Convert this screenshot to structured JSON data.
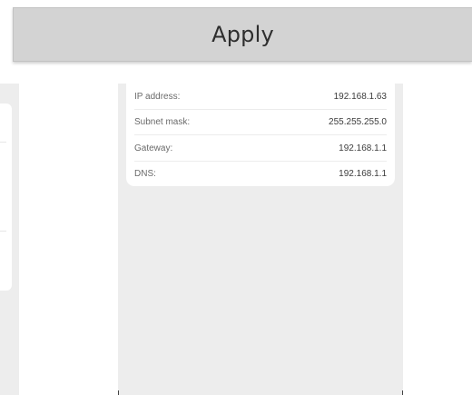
{
  "apply_bar": {
    "label": "Apply"
  },
  "network_info": {
    "rows": [
      {
        "label": "IP address:",
        "value": "192.168.1.63"
      },
      {
        "label": "Subnet mask:",
        "value": "255.255.255.0"
      },
      {
        "label": "Gateway:",
        "value": "192.168.1.1"
      },
      {
        "label": "DNS:",
        "value": "192.168.1.1"
      }
    ]
  },
  "colors": {
    "apply_bar_bg": "#d3d3d3",
    "panel_bg": "#ededed",
    "card_bg": "#ffffff",
    "text": "#3c3c3c"
  }
}
